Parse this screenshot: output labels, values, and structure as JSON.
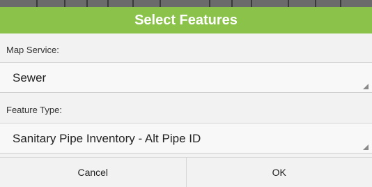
{
  "dialog": {
    "title": "Select Features"
  },
  "map_service": {
    "label": "Map Service:",
    "selected": "Sewer"
  },
  "feature_type": {
    "label": "Feature Type:",
    "selected": "Sanitary Pipe Inventory - Alt Pipe ID"
  },
  "buttons": {
    "cancel": "Cancel",
    "ok": "OK"
  },
  "colors": {
    "title_bar": "#8bc34a",
    "title_text": "#ffffff",
    "background": "#f2f2f2"
  },
  "icons": {
    "select_caret": "dropdown-caret-icon"
  }
}
